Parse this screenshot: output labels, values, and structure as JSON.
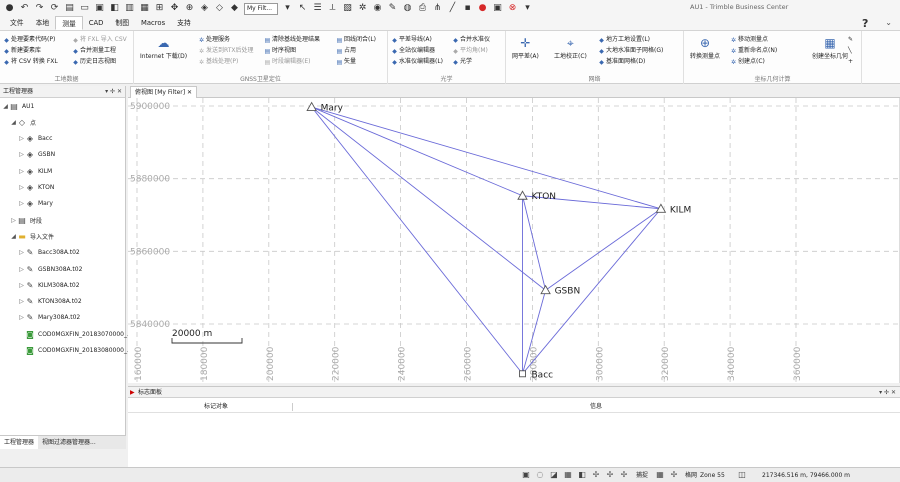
{
  "window": {
    "title": "AU1 - Trimble Business Center"
  },
  "qat": {
    "filter_value": "My Filt..."
  },
  "tabs": [
    "文件",
    "本地",
    "测量",
    "CAD",
    "制图",
    "Macros",
    "支持"
  ],
  "active_tab": "测量",
  "help_label": "?",
  "ribbon": {
    "group1": {
      "label": "工地数据",
      "items": [
        "处理要素代码(P)",
        "将 FXL 导入 CSV",
        "新建要素库",
        "合并测量工程",
        "将 CSV 转换 FXL",
        "历史日志视图"
      ]
    },
    "group2": {
      "label": "GNSS卫星定位",
      "big": "Internet 下载(D)",
      "items": [
        "处理服务",
        "清除基线处理结果",
        "回线闭合(L)",
        "发送到RTX后处理",
        "时序视图",
        "占用",
        "基线处理(P)",
        "时段编辑器(E)",
        "矢量"
      ]
    },
    "group3": {
      "label": "光学",
      "items": [
        "平差导线(A)",
        "合并水准仪",
        "全站仪编辑器",
        "平均角(M)",
        "水准仪编辑器(L)",
        "光学"
      ]
    },
    "group4": {
      "label": "网络",
      "big1": "网平差(A)",
      "big2": "工地校正(C)",
      "items": [
        "地方工地设置(L)",
        "大地水准面子网格(G)",
        "基准面网格(D)"
      ]
    },
    "group5": {
      "label": "坐标几何计算",
      "big": "转换测量点",
      "items": [
        "移动测量点",
        "重新命名点(N)",
        "创建点(C)",
        "创建坐标几何"
      ]
    }
  },
  "explorer": {
    "title": "工程管理器",
    "nodes": [
      {
        "label": "AU1",
        "level": 0,
        "icon": "project-icon"
      },
      {
        "label": "点",
        "level": 1,
        "icon": "point-group-icon"
      },
      {
        "label": "Bacc",
        "level": 2,
        "icon": "point-icon"
      },
      {
        "label": "GSBN",
        "level": 2,
        "icon": "point-icon"
      },
      {
        "label": "KILM",
        "level": 2,
        "icon": "point-icon"
      },
      {
        "label": "KTON",
        "level": 2,
        "icon": "point-icon"
      },
      {
        "label": "Mary",
        "level": 2,
        "icon": "point-icon"
      },
      {
        "label": "时段",
        "level": 1,
        "icon": "session-icon"
      },
      {
        "label": "导入文件",
        "level": 1,
        "icon": "folder-icon"
      },
      {
        "label": "Bacc308A.t02",
        "level": 2,
        "icon": "file-icon"
      },
      {
        "label": "GSBN308A.t02",
        "level": 2,
        "icon": "file-icon"
      },
      {
        "label": "KILM308A.t02",
        "level": 2,
        "icon": "file-icon"
      },
      {
        "label": "KTON308A.t02",
        "level": 2,
        "icon": "file-icon"
      },
      {
        "label": "Mary308A.t02",
        "level": 2,
        "icon": "file-icon"
      },
      {
        "label": "COD0MGXFIN_20183070000_...",
        "level": 2,
        "icon": "data-file-icon"
      },
      {
        "label": "COD0MGXFIN_20183080000_...",
        "level": 2,
        "icon": "data-file-icon"
      }
    ],
    "bottom_tabs": [
      "工程管理器",
      "视图过滤器管理器..."
    ]
  },
  "view": {
    "tab_label": "俯视图 [My Filter]",
    "scale_label": "20000 m",
    "y_ticks": [
      "5900000",
      "5880000",
      "5860000",
      "5840000"
    ],
    "x_ticks": [
      "160000",
      "180000",
      "200000",
      "220000",
      "240000",
      "260000",
      "280000",
      "300000",
      "320000",
      "340000",
      "360000"
    ],
    "points": [
      {
        "name": "Mary",
        "e": 213000,
        "n": 5899700,
        "symbol": "triangle"
      },
      {
        "name": "KTON",
        "e": 277000,
        "n": 5875300,
        "symbol": "triangle"
      },
      {
        "name": "KILM",
        "e": 319000,
        "n": 5871700,
        "symbol": "triangle"
      },
      {
        "name": "GSBN",
        "e": 284000,
        "n": 5849300,
        "symbol": "triangle"
      },
      {
        "name": "Bacc",
        "e": 277000,
        "n": 5826300,
        "symbol": "square"
      }
    ],
    "lines": [
      [
        "Mary",
        "KTON"
      ],
      [
        "Mary",
        "KILM"
      ],
      [
        "Mary",
        "GSBN"
      ],
      [
        "Mary",
        "Bacc"
      ],
      [
        "KTON",
        "KILM"
      ],
      [
        "KTON",
        "GSBN"
      ],
      [
        "KTON",
        "Bacc"
      ],
      [
        "KILM",
        "GSBN"
      ],
      [
        "KILM",
        "Bacc"
      ],
      [
        "GSBN",
        "Bacc"
      ]
    ]
  },
  "flags": {
    "title": "标志面板",
    "col1": "标记对象",
    "col2": "信息"
  },
  "status": {
    "snap_label": "捕捉",
    "grid_label": "格网",
    "zone": "Zone 55",
    "coords": "217346.516 m, 79466.000 m"
  },
  "colors": {
    "network_line": "#6a6ad8",
    "grid": "#c8c8c8"
  }
}
